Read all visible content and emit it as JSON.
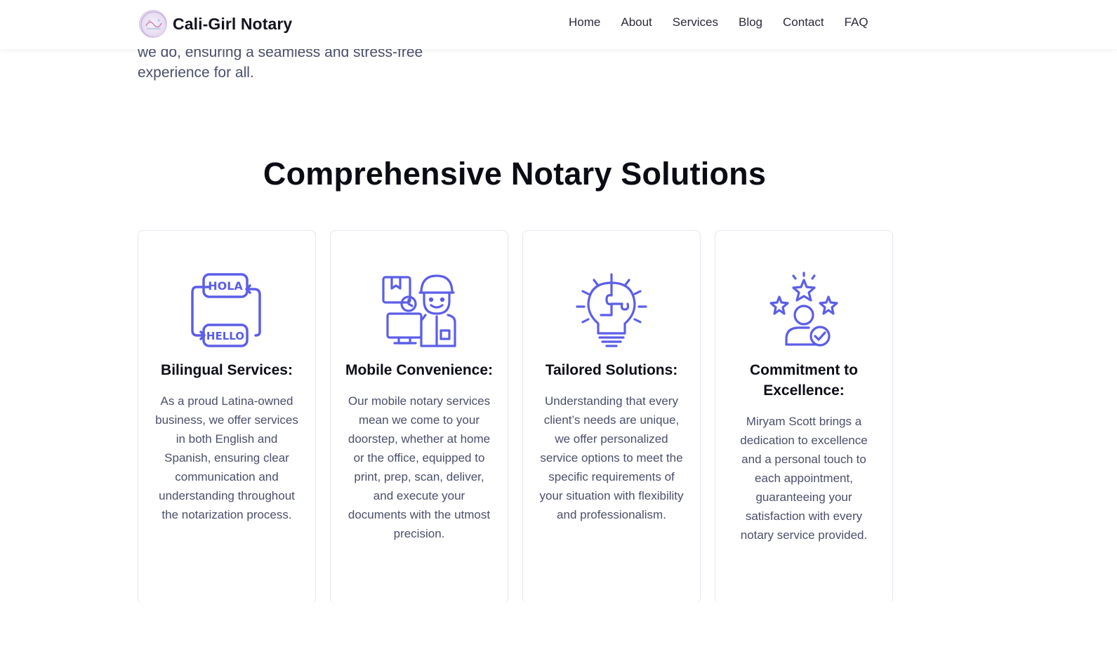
{
  "header": {
    "brand": "Cali-Girl Notary",
    "nav": [
      {
        "label": "Home"
      },
      {
        "label": "About"
      },
      {
        "label": "Services"
      },
      {
        "label": "Blog"
      },
      {
        "label": "Contact"
      },
      {
        "label": "FAQ"
      }
    ]
  },
  "intro": {
    "text": "we do, ensuring a seamless and stress-free experience for all."
  },
  "section": {
    "title": "Comprehensive Notary Solutions"
  },
  "cards": [
    {
      "icon": "translation-hola-hello-icon",
      "title": "Bilingual Services:",
      "text": "As a proud Latina-owned business, we offer services in both English and Spanish, ensuring clear communication and understanding throughout the notarization process."
    },
    {
      "icon": "mobile-delivery-person-icon",
      "title": "Mobile Convenience:",
      "text": "Our mobile notary services mean we come to your doorstep, whether at home or the office, equipped to print, prep, scan, deliver, and execute your documents with the utmost precision."
    },
    {
      "icon": "lightbulb-puzzle-icon",
      "title": "Tailored Solutions:",
      "text": "Understanding that every client’s needs are unique, we offer personalized service options to meet the specific requirements of your situation with flexibility and professionalism."
    },
    {
      "icon": "person-stars-check-icon",
      "title": "Commitment to Excellence:",
      "text": "Miryam Scott brings a dedication to excellence and a personal touch to each appointment, guaranteeing your satisfaction with every notary service provided."
    }
  ],
  "colors": {
    "accent": "#5b5ee8",
    "heading": "#0b0b14",
    "body_text": "#4a4f6a",
    "card_border": "#e4e6ee"
  }
}
